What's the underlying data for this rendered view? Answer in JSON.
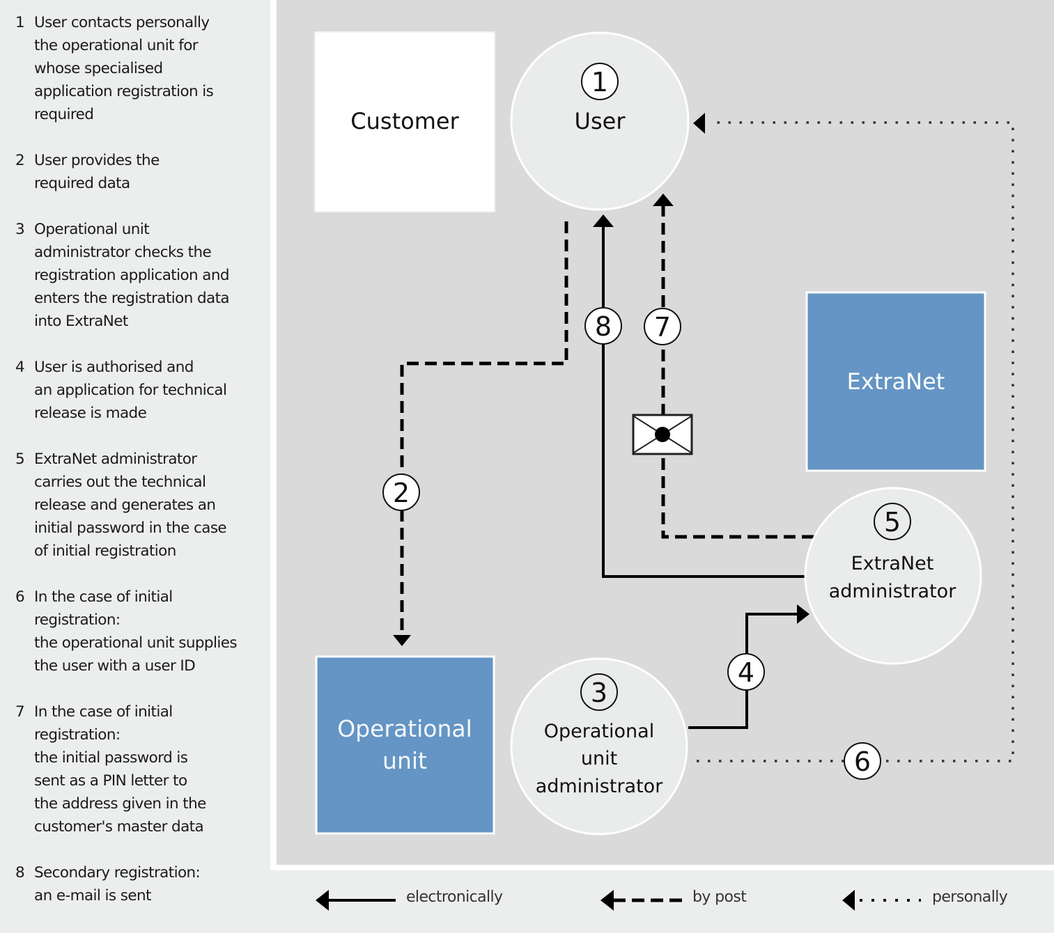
{
  "steps": [
    {
      "num": "1",
      "text": "User contacts personally\nthe operational unit for\nwhose specialised\napplication registration is\nrequired"
    },
    {
      "num": "2",
      "text": "User provides the\nrequired data"
    },
    {
      "num": "3",
      "text": "Operational unit\nadministrator checks the\nregistration application and\nenters the registration data\ninto ExtraNet"
    },
    {
      "num": "4",
      "text": "User is authorised and\nan application for technical\nrelease is made"
    },
    {
      "num": "5",
      "text": "ExtraNet administrator\ncarries out the technical\nrelease and generates an\ninitial password in the case\nof initial registration"
    },
    {
      "num": "6",
      "text": "In the case of initial\nregistration:\nthe operational unit supplies\nthe user with a user ID"
    },
    {
      "num": "7",
      "text": "In the case of initial\nregistration:\nthe initial password is\nsent as a PIN letter to\nthe address given in the\ncustomer's master data"
    },
    {
      "num": "8",
      "text": "Secondary registration:\nan e-mail is sent"
    }
  ],
  "nodes": {
    "customer": {
      "label": "Customer"
    },
    "user": {
      "num": "1",
      "label": "User"
    },
    "extranet": {
      "label": "ExtraNet"
    },
    "operational_unit": {
      "line1": "Operational",
      "line2": "unit"
    },
    "op_admin": {
      "num": "3",
      "line1": "Operational",
      "line2": "unit",
      "line3": "administrator"
    },
    "extranet_admin": {
      "num": "5",
      "line1": "ExtraNet",
      "line2": "administrator"
    }
  },
  "flow_markers": {
    "m2": "2",
    "m4": "4",
    "m6": "6",
    "m7": "7",
    "m8": "8"
  },
  "key": {
    "electronically": "electronically",
    "by_post": "by post",
    "personally": "personally"
  },
  "colors": {
    "blue_box": "#6495c4",
    "panel": "#dadada",
    "circle": "#eaebeb",
    "sidebar": "#eceeed"
  }
}
